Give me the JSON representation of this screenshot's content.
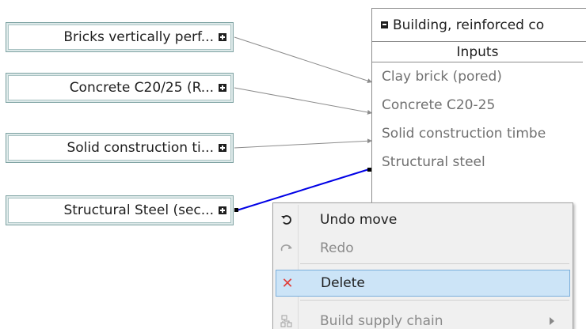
{
  "providers": [
    {
      "label": "Bricks vertically perf..."
    },
    {
      "label": "Concrete C20/25 (R..."
    },
    {
      "label": "Solid construction ti..."
    },
    {
      "label": "Structural Steel (sec..."
    }
  ],
  "process": {
    "title": "Building, reinforced co",
    "subheader": "Inputs",
    "inputs": [
      {
        "label": "Clay brick (pored)"
      },
      {
        "label": "Concrete C20-25"
      },
      {
        "label": "Solid construction timbe"
      },
      {
        "label": "Structural steel"
      }
    ]
  },
  "context_menu": {
    "items": [
      {
        "label": "Undo move",
        "icon": "undo-icon",
        "enabled": true
      },
      {
        "label": "Redo",
        "icon": "redo-icon",
        "enabled": false
      },
      {
        "label": "Delete",
        "icon": "delete-x-icon",
        "enabled": true,
        "highlighted": true
      },
      {
        "label": "Build supply chain",
        "icon": "supply-chain-icon",
        "enabled": false,
        "has_submenu": true
      }
    ]
  },
  "colors": {
    "link_default": "#8c8c8c",
    "link_selected": "#0000e6",
    "menu_highlight": "#cce4f7",
    "delete_icon": "#e0403c"
  }
}
